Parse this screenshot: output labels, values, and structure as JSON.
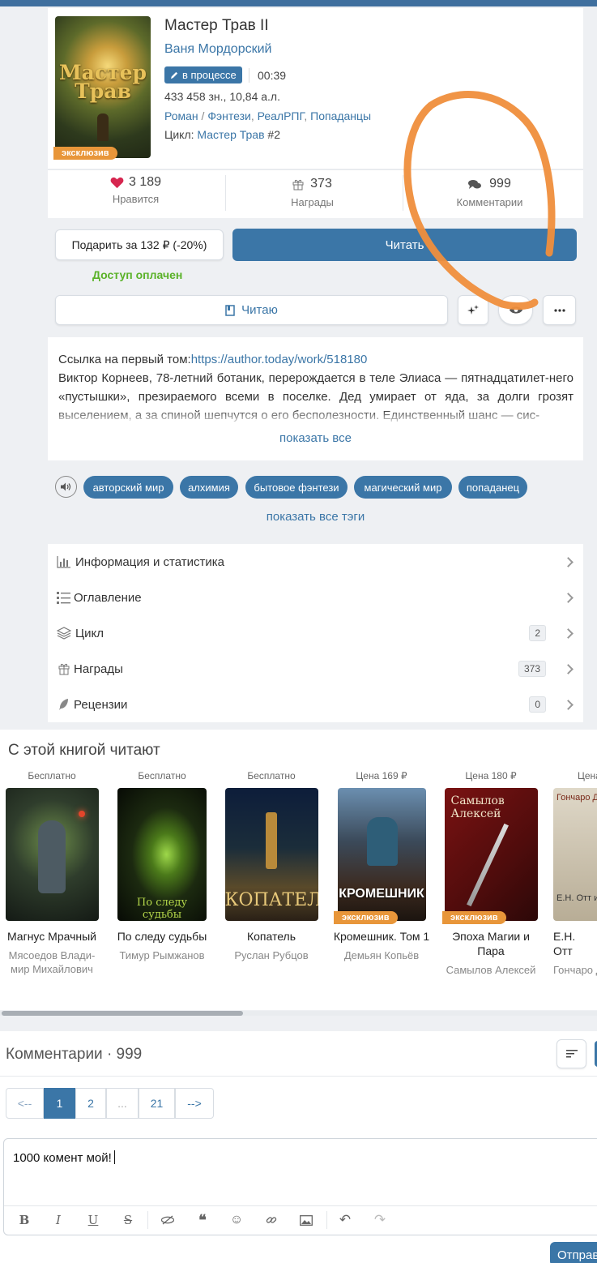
{
  "book": {
    "title": "Мастер Трав II",
    "author": "Ваня Мордорский",
    "status": "в процессе",
    "time": "00:39",
    "size": "433 458 зн., 10,84 а.л.",
    "genres": [
      "Роман",
      "Фэнтези",
      "РеалРПГ",
      "Попаданцы"
    ],
    "cycle_label": "Цикл:",
    "cycle_name": "Мастер Трав",
    "cycle_num": "#2",
    "cover_text": "Мастер Трав",
    "exclusive": "эксклюзив"
  },
  "stats": {
    "likes_value": "3 189",
    "likes_label": "Нравится",
    "awards_value": "373",
    "awards_label": "Награды",
    "comments_value": "999",
    "comments_label": "Комментарии"
  },
  "actions": {
    "gift": "Подарить за 132 ₽ (-20%)",
    "read": "Читать",
    "access": "Доступ оплачен",
    "reading": "Читаю"
  },
  "annotation": {
    "link_label": "Ссылка на первый том:",
    "link_url": "https://author.today/work/518180",
    "text": "Виктор Корнеев, 78-летний ботаник, перерождается в теле Элиаса — пятнадцатилет-него «пустышки», презираемого всеми в поселке. Дед умирает от яда, за долги грозят выселением, а за спиной шепчутся о его бесполезности. Единственный шанс — сис-",
    "show_all": "показать все"
  },
  "tags": [
    "авторский мир",
    "алхимия",
    "бытовое фэнтези",
    "магический мир",
    "попаданец"
  ],
  "show_all_tags": "показать все тэги",
  "menu": [
    {
      "label": "Информация и статистика",
      "count": ""
    },
    {
      "label": "Оглавление",
      "count": ""
    },
    {
      "label": "Цикл",
      "count": "2"
    },
    {
      "label": "Награды",
      "count": "373"
    },
    {
      "label": "Рецензии",
      "count": "0"
    }
  ],
  "also_reading": {
    "heading": "С этой книгой читают",
    "books": [
      {
        "price": "Бесплатно",
        "title": "Магнус Мрачный",
        "author": "Мясоедов Влади-мир Михайлович",
        "exclusive": ""
      },
      {
        "price": "Бесплатно",
        "title": "По следу судьбы",
        "author": "Тимур Рымжанов",
        "exclusive": ""
      },
      {
        "price": "Бесплатно",
        "title": "Копатель",
        "author": "Руслан Рубцов",
        "exclusive": ""
      },
      {
        "price": "Цена 169 ₽",
        "title": "Кромешник. Том 1",
        "author": "Демьян Копьёв",
        "exclusive": "эксклюзив"
      },
      {
        "price": "Цена 180 ₽",
        "title": "Эпоха Магии и Пара",
        "author": "Самылов Алексей",
        "exclusive": "эксклюзив"
      },
      {
        "price": "Цена",
        "title": "Е.Н. Отт",
        "author": "Гончаро Дмит",
        "exclusive": ""
      }
    ],
    "cover_texts": [
      "",
      "По следу судьбы",
      "КОПАТЕЛЬ",
      "КРОМЕШНИК",
      "Самылов Алексей",
      "Е.Н. Отт и Е"
    ]
  },
  "comments": {
    "heading": "Комментарии · 999",
    "pages": [
      "<--",
      "1",
      "2",
      "...",
      "21",
      "-->"
    ],
    "input_text": "1000 комент мой!",
    "send": "Отправ"
  },
  "colors": {
    "accent": "#3b76a7",
    "orange": "#e8963a",
    "green": "#5ab228",
    "annotation_stroke": "#ef8e3c"
  }
}
